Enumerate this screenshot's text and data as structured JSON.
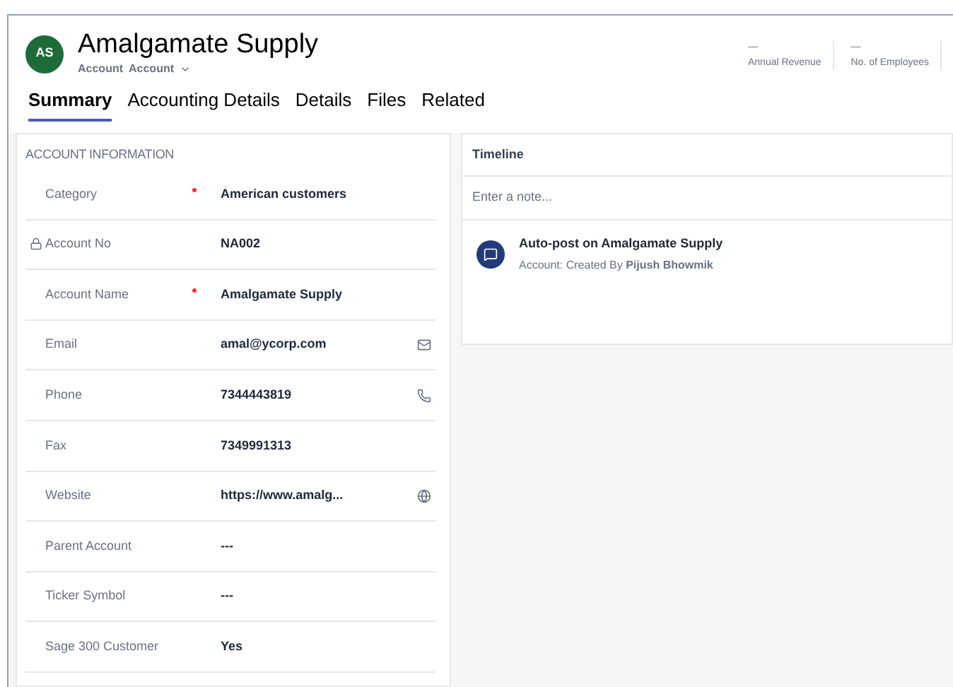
{
  "header": {
    "avatar": "AS",
    "title": "Amalgamate Supply",
    "entity": "Account",
    "form": "Account",
    "fields": [
      {
        "value": "—",
        "label": "Annual Revenue"
      },
      {
        "value": "—",
        "label": "No. of Employees"
      }
    ]
  },
  "tabs": [
    {
      "label": "Summary",
      "selected": true
    },
    {
      "label": "Accounting Details",
      "selected": false
    },
    {
      "label": "Details",
      "selected": false
    },
    {
      "label": "Files",
      "selected": false
    },
    {
      "label": "Related",
      "selected": false
    }
  ],
  "account_information": {
    "title": "ACCOUNT INFORMATION",
    "rows": [
      {
        "label": "Category",
        "value": "American customers",
        "required": true,
        "locked": false
      },
      {
        "label": "Account No",
        "value": "NA002",
        "required": false,
        "locked": true
      },
      {
        "label": "Account Name",
        "value": "Amalgamate Supply",
        "required": true,
        "locked": false
      },
      {
        "label": "Email",
        "value": "amal@ycorp.com",
        "required": false,
        "locked": false,
        "kind": "email"
      },
      {
        "label": "Phone",
        "value": "7344443819",
        "required": false,
        "locked": false,
        "kind": "phone"
      },
      {
        "label": "Fax",
        "value": "7349991313",
        "required": false,
        "locked": false
      },
      {
        "label": "Website",
        "value": "https://www.amalg...",
        "required": false,
        "locked": false,
        "kind": "globe"
      },
      {
        "label": "Parent Account",
        "value": "---",
        "required": false,
        "locked": false
      },
      {
        "label": "Ticker Symbol",
        "value": "---",
        "required": false,
        "locked": false
      },
      {
        "label": "Sage 300 Customer",
        "value": "Yes",
        "required": false,
        "locked": false
      }
    ]
  },
  "timeline": {
    "title": "Timeline",
    "placeholder": "Enter a note...",
    "posts": [
      {
        "title": "Auto-post on Amalgamate Supply",
        "text": "Account: Created By **Pijush Bhowmik**"
      }
    ]
  }
}
